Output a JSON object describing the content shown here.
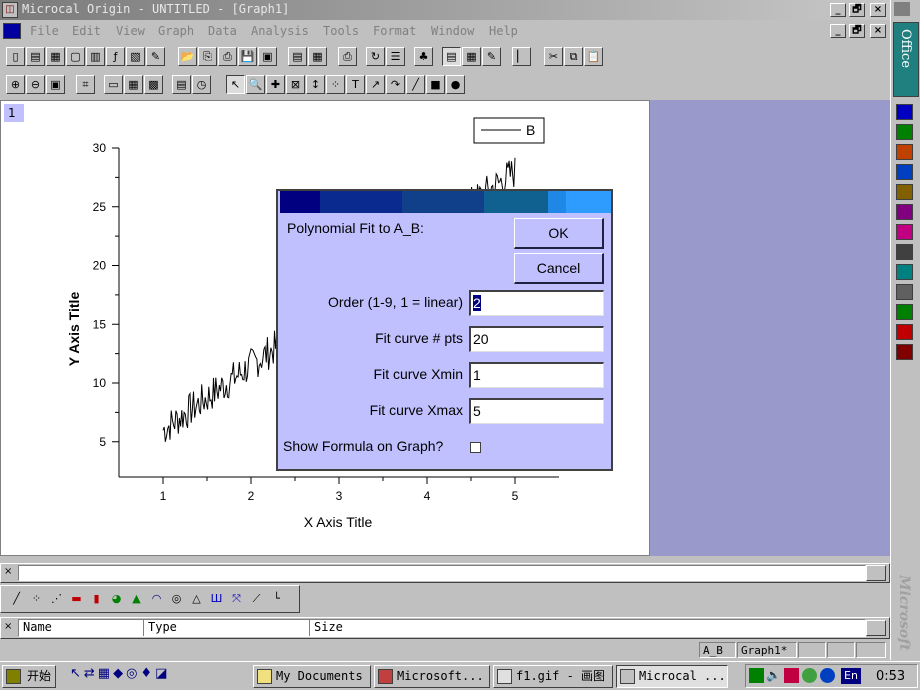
{
  "window": {
    "title": "Microcal Origin - UNTITLED - [Graph1]",
    "caption_buttons": [
      "_",
      "🗗",
      "×"
    ]
  },
  "menu": {
    "items": [
      "File",
      "Edit",
      "View",
      "Graph",
      "Data",
      "Analysis",
      "Tools",
      "Format",
      "Window",
      "Help"
    ]
  },
  "graph": {
    "layer": "1",
    "legend_label": "B",
    "x_axis_title": "X Axis Title",
    "y_axis_title": "Y Axis Title",
    "x_ticks": [
      "1",
      "2",
      "3",
      "4",
      "5"
    ],
    "y_ticks": [
      "5",
      "10",
      "15",
      "20",
      "25",
      "30"
    ]
  },
  "chart_data": {
    "type": "line",
    "x_range": [
      0.5,
      5.5
    ],
    "y_range": [
      2,
      30
    ],
    "series": [
      {
        "name": "B",
        "x_start": 1,
        "x_end": 5,
        "y_start": 6,
        "y_end": 28,
        "noise": 1.5
      }
    ]
  },
  "dialog": {
    "title": "Polynomial Fit to A_B:",
    "ok_label": "OK",
    "cancel_label": "Cancel",
    "order_label": "Order (1-9, 1 = linear)",
    "order_value": "2",
    "pts_label": "Fit curve # pts",
    "pts_value": "20",
    "xmin_label": "Fit curve Xmin",
    "xmin_value": "1",
    "xmax_label": "Fit curve Xmax",
    "xmax_value": "5",
    "formula_label": "Show Formula on Graph?",
    "title_bar_colors": [
      "#000080",
      "#0a2a90",
      "#10408a",
      "#106090",
      "#1f87e6",
      "#2e9bff"
    ]
  },
  "list_bar": {
    "columns": [
      "Name",
      "Type",
      "Size"
    ]
  },
  "status": {
    "dataset": "A_B",
    "window": "Graph1*"
  },
  "office_bar": {
    "label": "Office",
    "watermark": "Microsoft",
    "icon_colors": [
      "#0000c0",
      "#008000",
      "#c04000",
      "#0040c0",
      "#806000",
      "#800080",
      "#c00080",
      "#404040",
      "#008080",
      "#606060",
      "#008000",
      "#c00000",
      "#800000"
    ]
  },
  "taskbar": {
    "start_label": "开始",
    "tasks": [
      "My Documents",
      "Microsoft...",
      "f1.gif - 画图",
      "Microcal ..."
    ],
    "lang": "En",
    "clock": "0:53"
  }
}
